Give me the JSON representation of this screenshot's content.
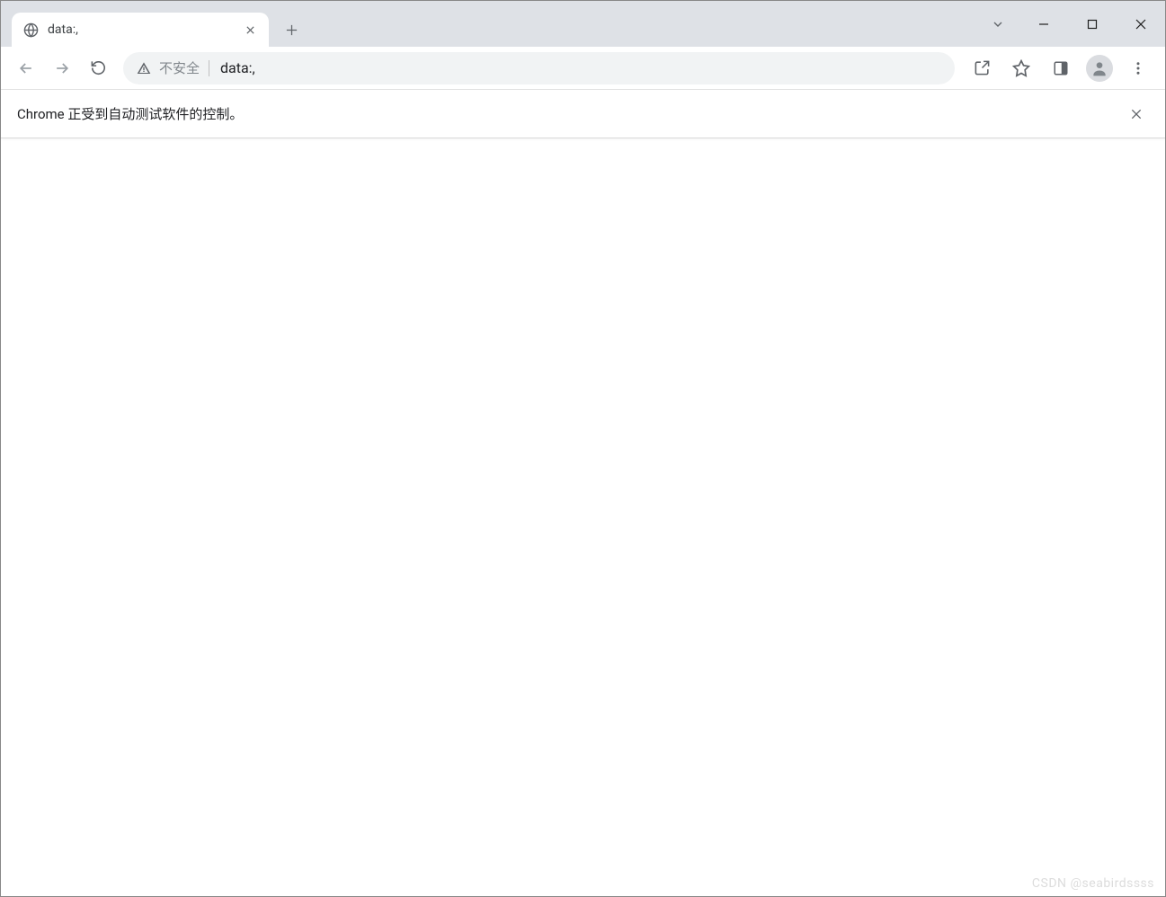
{
  "window_controls": {
    "dropdown": "chevron-down",
    "minimize": "minimize",
    "maximize": "maximize",
    "close": "close"
  },
  "tab": {
    "title": "data:,",
    "favicon": "globe-icon"
  },
  "toolbar": {
    "back_enabled": false,
    "forward_enabled": false,
    "security_label": "不安全",
    "url": "data:,"
  },
  "infobar": {
    "message": "Chrome 正受到自动测试软件的控制。"
  },
  "watermark": "CSDN @seabirdssss"
}
